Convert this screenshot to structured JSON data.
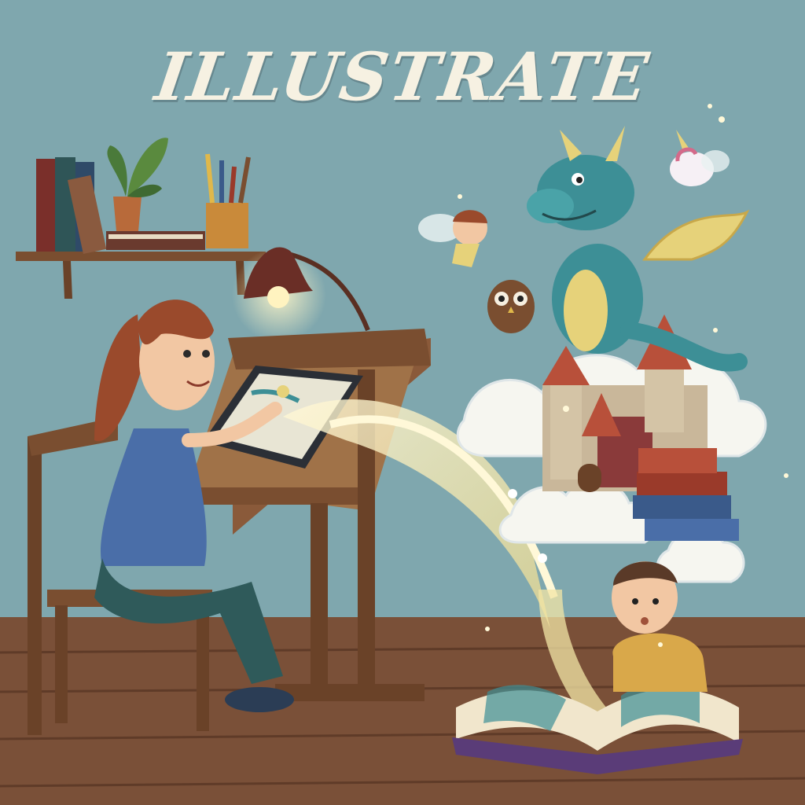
{
  "title": "ILLUSTRATE",
  "colors": {
    "wall": "#7fa7ae",
    "floor": "#7a5038",
    "wood": "#8a5a3a",
    "shirt_woman": "#4a6ea8",
    "pants_woman": "#2f5a5a",
    "hair_woman": "#9a4a2c",
    "dragon": "#3d8f96",
    "dragon_belly": "#e6d27a",
    "castle": "#c9b79a",
    "roof": "#b8503a",
    "magic_glow": "#f3e6a6"
  },
  "elements": [
    "bookshelf",
    "plant",
    "pencil-cup",
    "desk-lamp",
    "drawing-table",
    "tablet",
    "chair",
    "woman-artist",
    "magic-stream",
    "dragon",
    "castle",
    "fairy",
    "unicorn",
    "owl",
    "book-stack",
    "open-storybook",
    "boy-reader",
    "clouds",
    "sparkles"
  ]
}
